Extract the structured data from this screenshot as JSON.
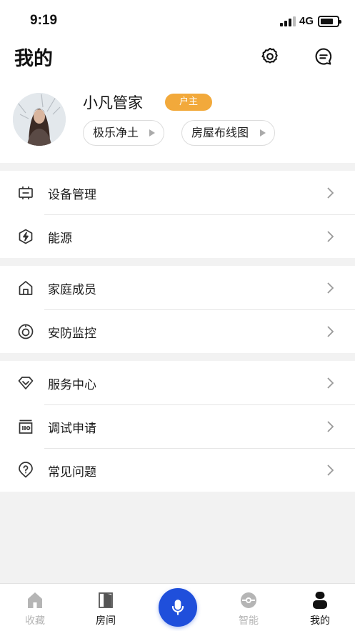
{
  "status_bar": {
    "time": "9:19",
    "network": "4G"
  },
  "header": {
    "title": "我的",
    "settings_icon": "gear-icon",
    "message_icon": "chat-icon"
  },
  "profile": {
    "name": "小凡管家",
    "role_badge": "户主",
    "badge_color": "#f2a93b",
    "chips": [
      {
        "label": "极乐净土"
      },
      {
        "label": "房屋布线图"
      }
    ]
  },
  "menu": {
    "groups": [
      {
        "items": [
          {
            "label": "设备管理",
            "icon": "device-icon"
          },
          {
            "label": "能源",
            "icon": "energy-icon"
          }
        ]
      },
      {
        "items": [
          {
            "label": "家庭成员",
            "icon": "home-icon"
          },
          {
            "label": "安防监控",
            "icon": "camera-icon"
          }
        ]
      },
      {
        "items": [
          {
            "label": "服务中心",
            "icon": "diamond-icon"
          },
          {
            "label": "调试申请",
            "icon": "debug-icon"
          },
          {
            "label": "常见问题",
            "icon": "question-icon"
          }
        ]
      }
    ]
  },
  "tab_bar": {
    "tabs": [
      {
        "label": "收藏",
        "icon": "house-icon"
      },
      {
        "label": "房间",
        "icon": "door-icon"
      },
      {
        "label": "智能",
        "icon": "smart-icon"
      },
      {
        "label": "我的",
        "icon": "person-icon"
      }
    ],
    "voice_icon": "microphone-icon",
    "accent_color": "#1f4fdb"
  }
}
